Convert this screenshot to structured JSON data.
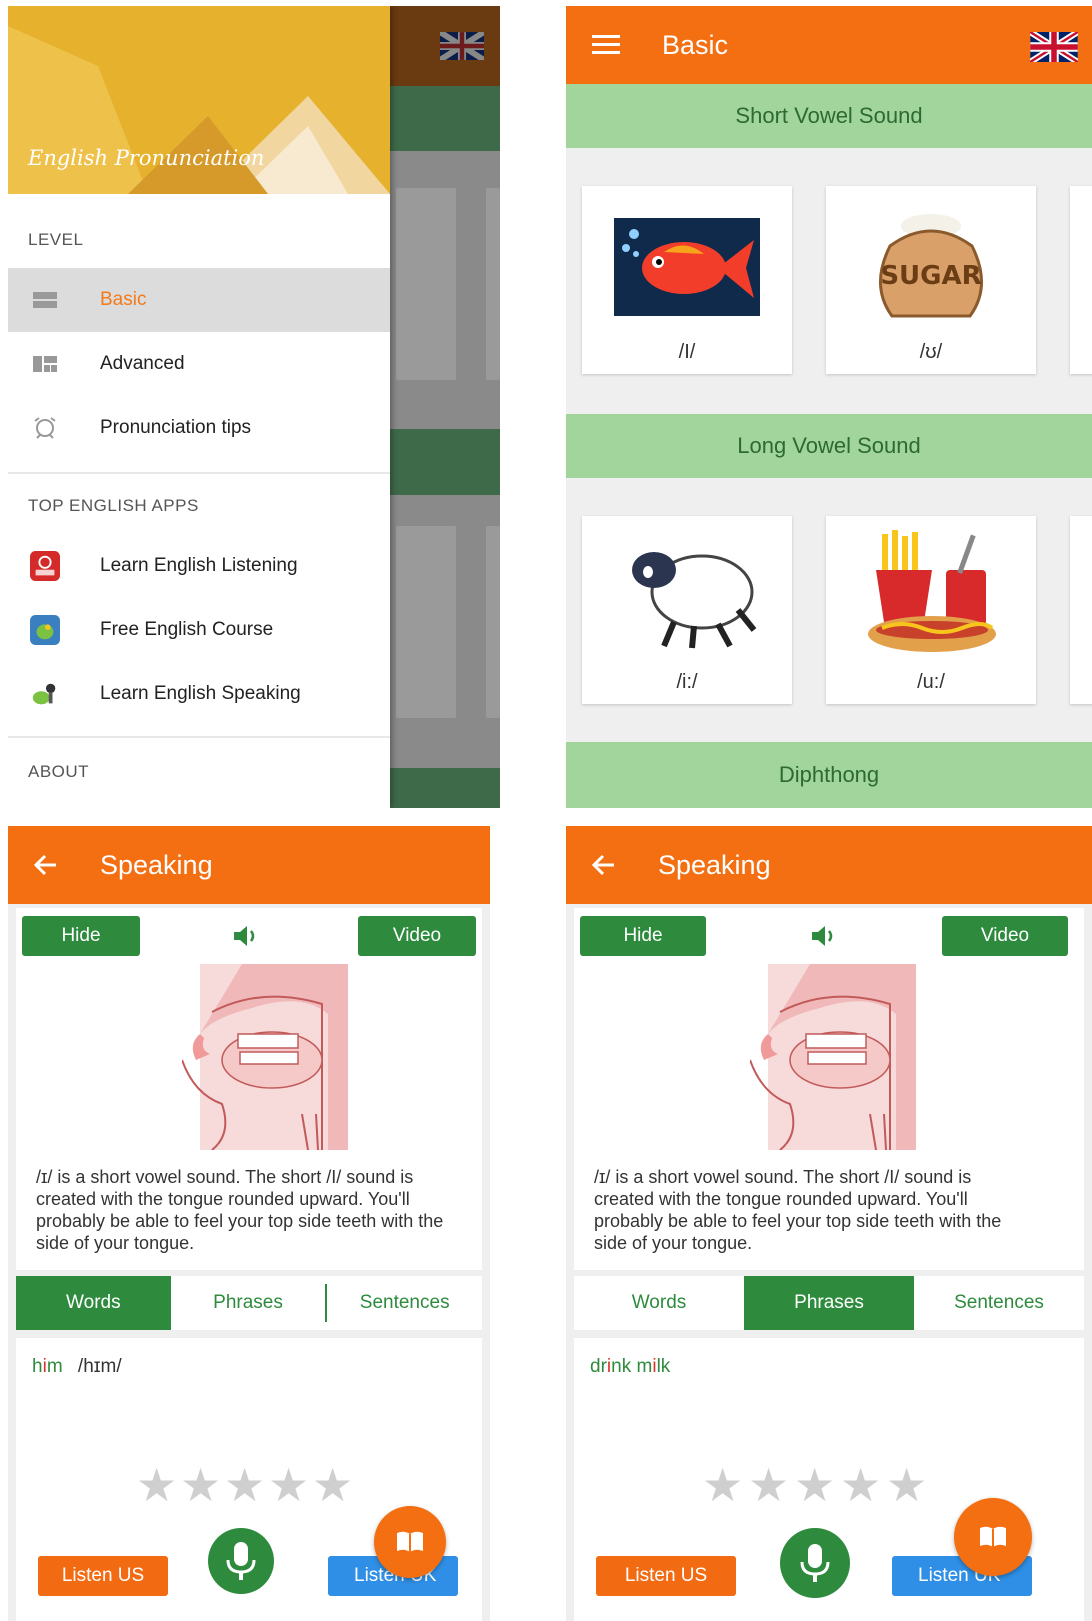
{
  "drawer": {
    "logo_text": "English Pronunciation",
    "level_title": "LEVEL",
    "level_items": [
      {
        "label": "Basic",
        "icon": "basic-level-icon",
        "active": true
      },
      {
        "label": "Advanced",
        "icon": "advanced-level-icon"
      },
      {
        "label": "Pronunciation tips",
        "icon": "tips-icon"
      }
    ],
    "apps_title": "TOP ENGLISH APPS",
    "apps": [
      {
        "label": "Learn English Listening",
        "icon": "listening-app-icon"
      },
      {
        "label": "Free English Course",
        "icon": "course-app-icon"
      },
      {
        "label": "Learn English Speaking",
        "icon": "speaking-app-icon"
      }
    ],
    "about_title": "ABOUT"
  },
  "basic": {
    "title": "Basic",
    "sections": [
      {
        "title": "Short Vowel Sound",
        "cards": [
          {
            "ipa": "/I/",
            "image": "fish-icon"
          },
          {
            "ipa": "/ʊ/",
            "image": "sugar-sack-icon"
          }
        ]
      },
      {
        "title": "Long Vowel Sound",
        "cards": [
          {
            "ipa": "/i:/",
            "image": "sheep-icon"
          },
          {
            "ipa": "/u:/",
            "image": "fast-food-icon"
          }
        ]
      },
      {
        "title": "Diphthong"
      }
    ]
  },
  "speaking": [
    {
      "title": "Speaking",
      "hide_label": "Hide",
      "video_label": "Video",
      "description": "/ɪ/ is a short vowel sound. The short /I/ sound is created with the tongue rounded upward. You'll probably be able to feel your top side teeth with the side of your tongue.",
      "tabs": [
        "Words",
        "Phrases",
        "Sentences"
      ],
      "selected_tab": "Words",
      "item": {
        "w1": "h",
        "w2": "i",
        "w3": "m",
        "ipa": "/hɪm/"
      },
      "rating": 0,
      "listen_us": "Listen US",
      "listen_uk": "Listen UK"
    },
    {
      "title": "Speaking",
      "hide_label": "Hide",
      "video_label": "Video",
      "description": "/ɪ/ is a short vowel sound. The short /I/ sound is created with the tongue rounded upward. You'll probably be able to feel your top side teeth with the side of your tongue.",
      "tabs": [
        "Words",
        "Phrases",
        "Sentences"
      ],
      "selected_tab": "Phrases",
      "item": {
        "p1": "dr",
        "p2": "i",
        "p3": "nk m",
        "p4": "i",
        "p5": "lk"
      },
      "rating": 0,
      "listen_us": "Listen US",
      "listen_uk": "Listen UK"
    }
  ],
  "colors": {
    "primary": "#f36f12",
    "green": "#2e8b3e",
    "band": "#a2d59b",
    "blue": "#2f8fe6"
  }
}
